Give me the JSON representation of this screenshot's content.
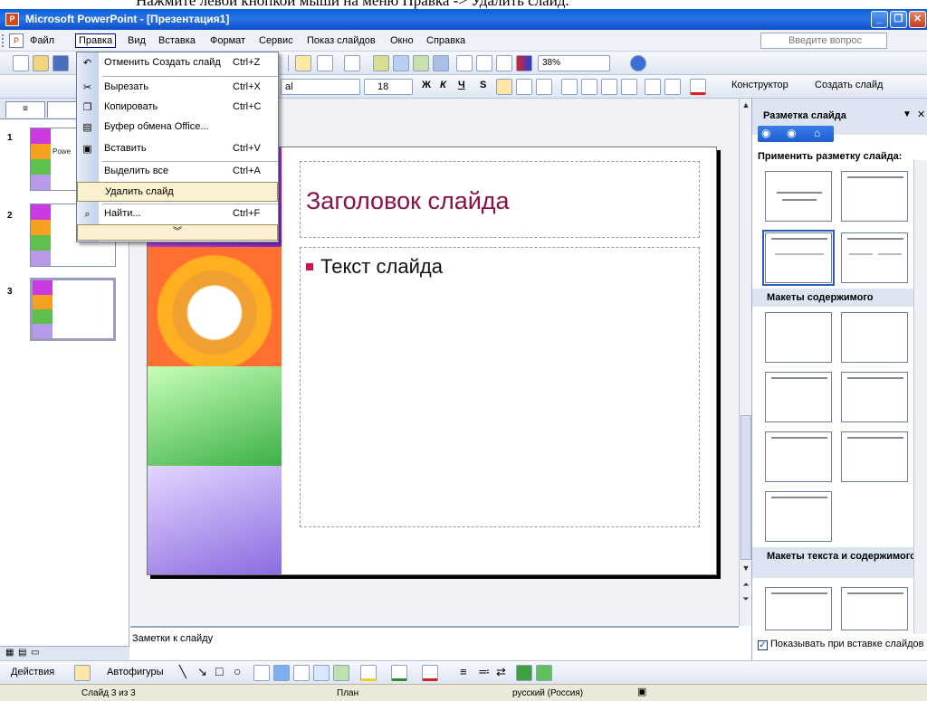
{
  "document_caption": "Нажмите левой кнопкой мыши на меню Правка -> Удалить слайд.",
  "window": {
    "title": "Microsoft PowerPoint - [Презентация1]",
    "minimize": "_",
    "restore": "❐",
    "close": "✕"
  },
  "menubar": {
    "items": [
      "Файл",
      "Правка",
      "Вид",
      "Вставка",
      "Формат",
      "Сервис",
      "Показ слайдов",
      "Окно",
      "Справка"
    ],
    "help_placeholder": "Введите вопрос"
  },
  "toolbar_standard": {
    "zoom": "38%"
  },
  "toolbar_formatting": {
    "font_name": "al",
    "font_size": "18",
    "designer": "Конструктор",
    "new_slide": "Создать слайд"
  },
  "edit_menu": {
    "items": [
      {
        "label": "Отменить Создать слайд",
        "shortcut": "Ctrl+Z",
        "icon": "undo-icon"
      },
      {
        "label": "Вырезать",
        "shortcut": "Ctrl+X",
        "icon": "cut-icon"
      },
      {
        "label": "Копировать",
        "shortcut": "Ctrl+C",
        "icon": "copy-icon"
      },
      {
        "label": "Буфер обмена Office...",
        "shortcut": "",
        "icon": "clipboard-icon"
      },
      {
        "label": "Вставить",
        "shortcut": "Ctrl+V",
        "icon": "paste-icon"
      },
      {
        "label": "Выделить все",
        "shortcut": "Ctrl+A",
        "icon": ""
      },
      {
        "label": "Удалить слайд",
        "shortcut": "",
        "icon": ""
      },
      {
        "label": "Найти...",
        "shortcut": "Ctrl+F",
        "icon": "find-icon"
      }
    ],
    "highlighted": "Удалить слайд"
  },
  "slides_panel": {
    "numbers": [
      "1",
      "2",
      "3"
    ],
    "selected": "3",
    "thumb1_text": "Powe",
    "tab_outline": "≡"
  },
  "slide": {
    "title": "Заголовок слайда",
    "body": "Текст слайда"
  },
  "notes": {
    "placeholder": "Заметки к слайду"
  },
  "task_pane": {
    "title": "Разметка слайда",
    "apply_label": "Применить разметку слайда:",
    "section_content": "Макеты содержимого",
    "section_text_content": "Макеты текста и содержимого",
    "show_on_insert": "Показывать при вставке слайдов"
  },
  "drawing_toolbar": {
    "actions": "Действия",
    "autoshapes": "Автофигуры"
  },
  "status": {
    "slide_counter": "Слайд 3 из 3",
    "design": "План",
    "language": "русский (Россия)"
  },
  "colors": {
    "title_text": "#8a1048",
    "bullet": "#d0105a",
    "menu_highlight": "#fbf0d0",
    "titlebar": "#0a5fd8"
  }
}
